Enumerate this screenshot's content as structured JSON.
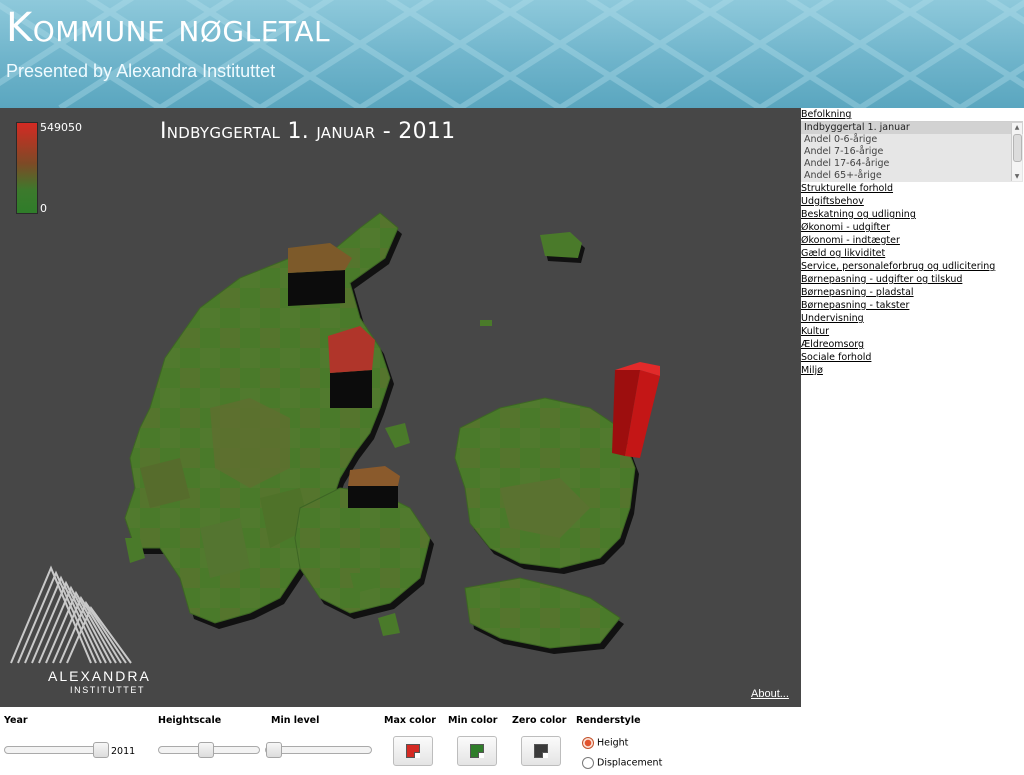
{
  "header": {
    "title": "Kommune nøgletal",
    "subtitle": "Presented by Alexandra Instituttet"
  },
  "map": {
    "title": "Indbyggertal 1. januar - 2011",
    "legend_max": "549050",
    "legend_min": "0",
    "about_label": "About...",
    "logo_line1": "ALEXANDRA",
    "logo_line2": "INSTITUTTET"
  },
  "sidebar": {
    "top_category": "Befolkning",
    "sub_items": [
      "Indbyggertal 1. januar",
      "Andel 0-6-årige",
      "Andel 7-16-årige",
      "Andel 17-64-årige",
      "Andel 65+-årige"
    ],
    "selected_index": 0,
    "categories": [
      "Strukturelle forhold",
      "Udgiftsbehov",
      "Beskatning og udligning",
      "Økonomi - udgifter",
      "Økonomi - indtægter",
      "Gæld og likviditet",
      "Service, personaleforbrug og udlicitering",
      "Børnepasning - udgifter og tilskud",
      "Børnepasning - pladstal",
      "Børnepasning - takster",
      "Undervisning",
      "Kultur",
      "Ældreomsorg",
      "Sociale forhold",
      "Miljø"
    ]
  },
  "controls": {
    "year_label": "Year",
    "year_value": "2011",
    "heightscale_label": "Heightscale",
    "minlevel_label": "Min level",
    "maxcolor_label": "Max color",
    "mincolor_label": "Min color",
    "zerocolor_label": "Zero color",
    "renderstyle_label": "Renderstyle",
    "radio_height": "Height",
    "radio_displacement": "Displacement",
    "selected_renderstyle": "Height",
    "year_slider_fraction": 1.0,
    "heightscale_fraction": 0.45,
    "minlevel_fraction": 0.0
  },
  "colors": {
    "max": "#d42a23",
    "min": "#2f7d2a",
    "zero": "#3a3a3a",
    "map_bg": "#474747"
  }
}
